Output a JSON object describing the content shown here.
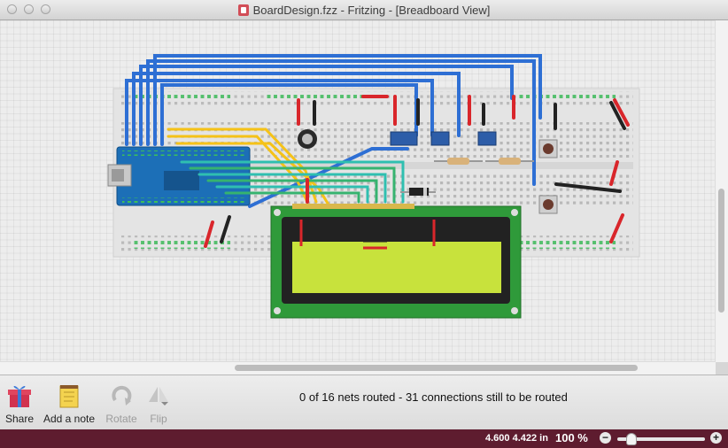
{
  "window": {
    "title": "BoardDesign.fzz - Fritzing - [Breadboard View]",
    "colors": {
      "statusbar": "#5e1c2f",
      "wire_blue": "#2e6fd4",
      "wire_yellow": "#f5c218",
      "wire_red": "#d9262b",
      "lcd_board": "#2f9a3a",
      "lcd_screen": "#c8e23c"
    }
  },
  "canvas": {
    "breadboard_label": "breadboard",
    "arduino_label": "Arduino Nano",
    "lcd_label": "LCD 16x2"
  },
  "toolbar": {
    "share": {
      "label": "Share",
      "icon": "gift-icon"
    },
    "add_note": {
      "label": "Add a note",
      "icon": "note-icon"
    },
    "rotate": {
      "label": "Rotate",
      "icon": "rotate-icon",
      "enabled": false
    },
    "flip": {
      "label": "Flip",
      "icon": "flip-icon",
      "enabled": false
    }
  },
  "status": {
    "routing": "0 of 16 nets routed - 31 connections still to be routed"
  },
  "statusbar": {
    "coordinates": "4.600 4.422 in",
    "zoom": "100 %",
    "zoom_out": "−",
    "zoom_in": "+",
    "zoom_fraction": 0.12
  }
}
